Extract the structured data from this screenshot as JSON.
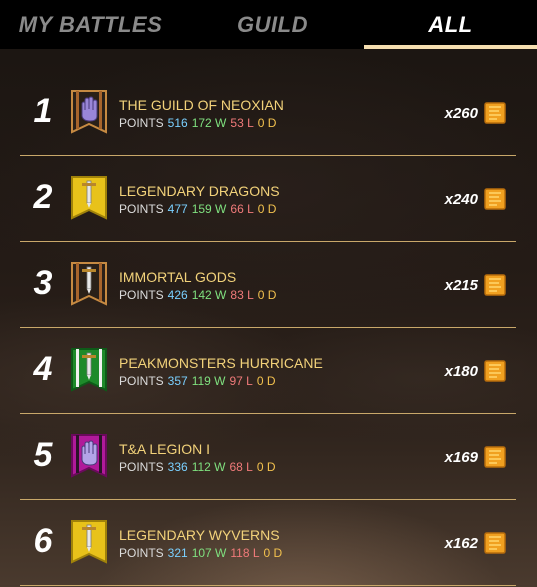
{
  "tabs": [
    {
      "label": "MY BATTLES",
      "active": false
    },
    {
      "label": "GUILD",
      "active": false
    },
    {
      "label": "ALL",
      "active": true
    }
  ],
  "labels": {
    "points": "POINTS"
  },
  "colors": {
    "name": "#f2d27a",
    "points": "#7ad0ff",
    "wins": "#7fe07f",
    "losses": "#f07a7a",
    "draws": "#f2c14e",
    "divider": "#c9a86a"
  },
  "guilds": [
    {
      "rank": "1",
      "name": "THE GUILD OF NEOXIAN",
      "points": "516",
      "wins": "172 W",
      "losses": "53 L",
      "draws": "0 D",
      "reward": "x260",
      "crest": "hand-black-purple-icon"
    },
    {
      "rank": "2",
      "name": "LEGENDARY DRAGONS",
      "points": "477",
      "wins": "159 W",
      "losses": "66 L",
      "draws": "0 D",
      "reward": "x240",
      "crest": "sword-yellow-banner-icon"
    },
    {
      "rank": "3",
      "name": "IMMORTAL GODS",
      "points": "426",
      "wins": "142 W",
      "losses": "83 L",
      "draws": "0 D",
      "reward": "x215",
      "crest": "sword-black-banner-icon"
    },
    {
      "rank": "4",
      "name": "PEAKMONSTERS HURRICANE",
      "points": "357",
      "wins": "119 W",
      "losses": "97 L",
      "draws": "0 D",
      "reward": "x180",
      "crest": "sword-green-banner-icon"
    },
    {
      "rank": "5",
      "name": "T&A LEGION I",
      "points": "336",
      "wins": "112 W",
      "losses": "68 L",
      "draws": "0 D",
      "reward": "x169",
      "crest": "hand-magenta-banner-icon"
    },
    {
      "rank": "6",
      "name": "LEGENDARY WYVERNS",
      "points": "321",
      "wins": "107 W",
      "losses": "118 L",
      "draws": "0 D",
      "reward": "x162",
      "crest": "sword-yellow-banner-icon"
    }
  ]
}
